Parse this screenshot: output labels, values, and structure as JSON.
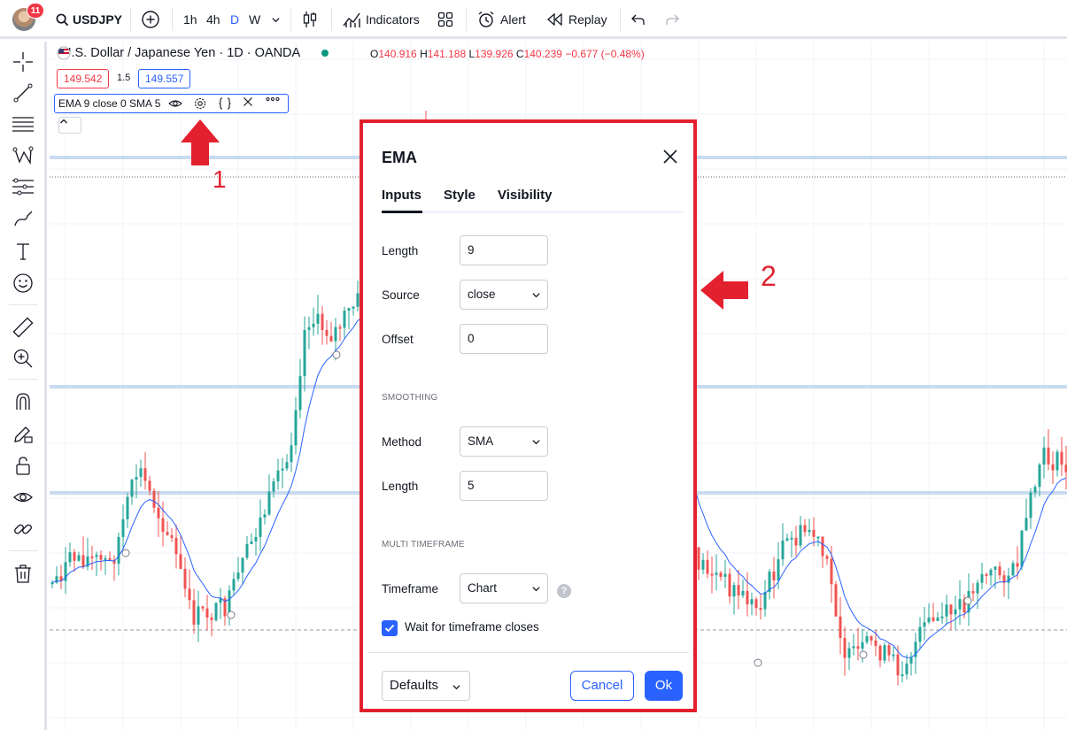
{
  "toolbar": {
    "notification_count": "11",
    "symbol": "USDJPY",
    "intervals": [
      "1h",
      "4h",
      "D",
      "W"
    ],
    "active_interval": "D",
    "indicators_label": "Indicators",
    "alert_label": "Alert",
    "replay_label": "Replay"
  },
  "chart": {
    "title": "U.S. Dollar / Japanese Yen · 1D · OANDA",
    "ohlc": {
      "open_key": "O",
      "open": "140.916",
      "high_key": "H",
      "high": "141.188",
      "low_key": "L",
      "low": "139.926",
      "close_key": "C",
      "close": "140.239",
      "change": "−0.677 (−0.48%)"
    },
    "sell_price": "149.542",
    "spread": "1.5",
    "buy_price": "149.557",
    "indicator_legend": "EMA 9 close 0 SMA 5",
    "colors": {
      "up": "#26a69a",
      "down": "#ef5350",
      "ema": "#2962ff",
      "accent": "#2962ff",
      "annotation": "#e3202e"
    }
  },
  "annotations": {
    "step1": "1",
    "step2": "2"
  },
  "dialog": {
    "title": "EMA",
    "tabs": [
      "Inputs",
      "Style",
      "Visibility"
    ],
    "active_tab": "Inputs",
    "fields": {
      "length_label": "Length",
      "length_value": "9",
      "source_label": "Source",
      "source_value": "close",
      "offset_label": "Offset",
      "offset_value": "0",
      "smoothing_section": "SMOOTHING",
      "method_label": "Method",
      "method_value": "SMA",
      "smoothing_length_label": "Length",
      "smoothing_length_value": "5",
      "mtf_section": "MULTI TIMEFRAME",
      "timeframe_label": "Timeframe",
      "timeframe_value": "Chart",
      "wait_label": "Wait for timeframe closes",
      "wait_checked": true
    },
    "buttons": {
      "defaults": "Defaults",
      "cancel": "Cancel",
      "ok": "Ok"
    }
  }
}
